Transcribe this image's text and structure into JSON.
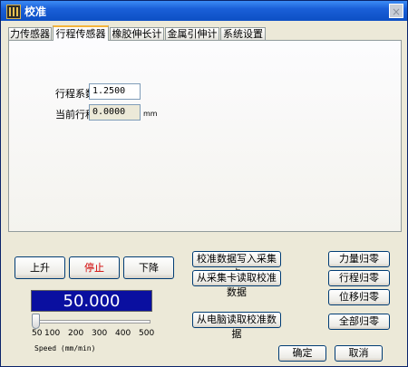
{
  "window": {
    "title": "校准",
    "close_glyph": "×"
  },
  "tabs": [
    {
      "label": "力传感器"
    },
    {
      "label": "行程传感器"
    },
    {
      "label": "橡胶伸长计"
    },
    {
      "label": "金属引伸计"
    },
    {
      "label": "系统设置"
    }
  ],
  "stroke_panel": {
    "coefficient_label": "行程系数",
    "coefficient_value": "1.2500",
    "current_label": "当前行程",
    "current_value": "0.0000",
    "current_unit": "mm"
  },
  "motion": {
    "up": "上升",
    "stop": "停止",
    "down": "下降"
  },
  "speed": {
    "display": "50.000",
    "value": 50,
    "ticks": [
      "50",
      "100",
      "200",
      "300",
      "400",
      "500"
    ],
    "caption": "Speed (mm/min)"
  },
  "calib_buttons": {
    "write": "校准数据写入采集卡",
    "read_card": "从采集卡读取校准数据",
    "read_pc": "从电脑读取校准数据"
  },
  "zero_buttons": {
    "force": "力量归零",
    "stroke": "行程归零",
    "displacement": "位移归零",
    "all": "全部归零"
  },
  "dialog": {
    "ok": "确定",
    "cancel": "取消"
  },
  "colors": {
    "title_bar": "#1a5fd8",
    "display_bg": "#0a0fa0",
    "stop_text": "#d00000"
  }
}
